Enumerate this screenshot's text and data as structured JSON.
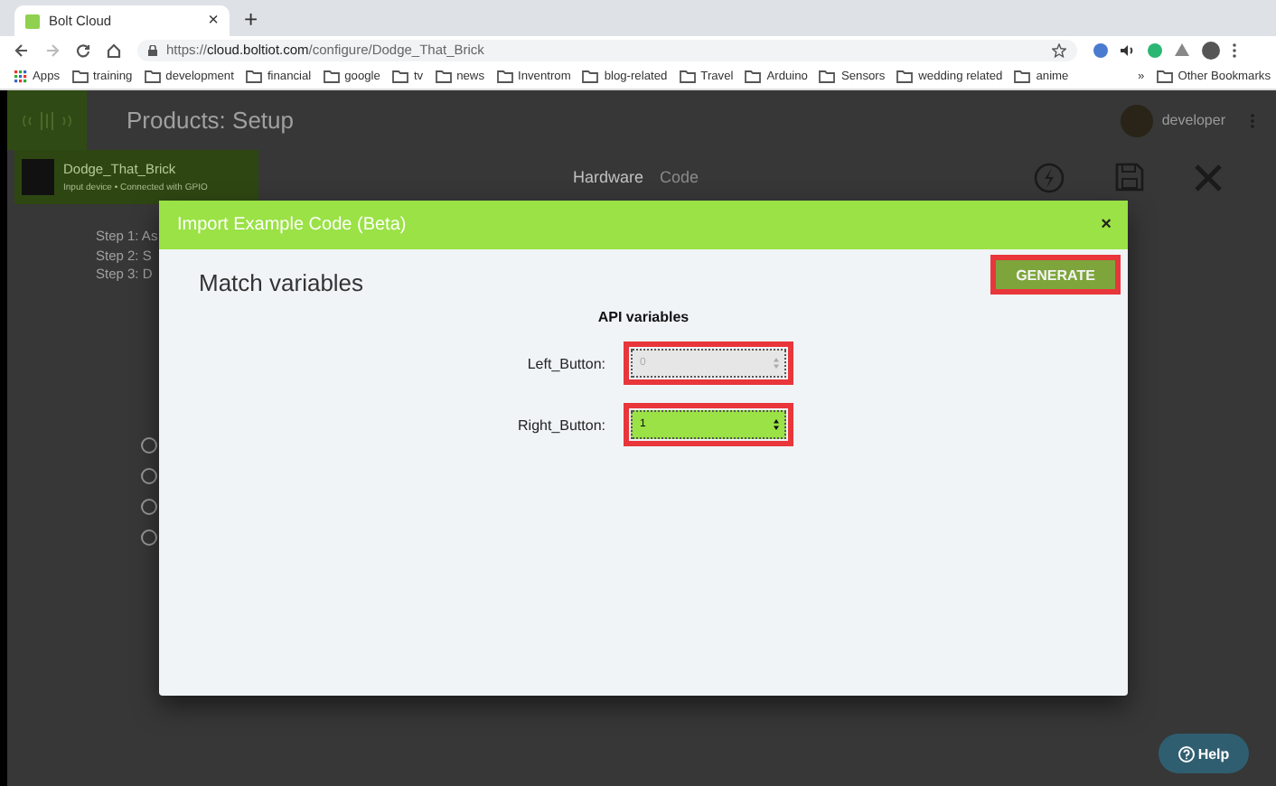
{
  "browser": {
    "tab": {
      "title": "Bolt Cloud",
      "close": "×"
    },
    "new_tab": "+",
    "url": "https://**cloud.boltiot.com**/configure/Dodge_That_Brick",
    "bookmarks": [
      {
        "label": "Apps",
        "kind": "apps"
      },
      {
        "label": "training",
        "kind": "folder"
      },
      {
        "label": "development",
        "kind": "folder"
      },
      {
        "label": "financial",
        "kind": "folder"
      },
      {
        "label": "google",
        "kind": "folder"
      },
      {
        "label": "tv",
        "kind": "folder"
      },
      {
        "label": "news",
        "kind": "folder"
      },
      {
        "label": "Inventrom",
        "kind": "folder"
      },
      {
        "label": "blog-related",
        "kind": "folder"
      },
      {
        "label": "Travel",
        "kind": "folder"
      },
      {
        "label": "Arduino",
        "kind": "folder"
      },
      {
        "label": "Sensors",
        "kind": "folder"
      },
      {
        "label": "wedding related",
        "kind": "folder"
      },
      {
        "label": "anime",
        "kind": "folder"
      }
    ],
    "overflow": "»",
    "other_bookmarks": "Other Bookmarks"
  },
  "app": {
    "title": "Products: Setup",
    "user": "developer",
    "product": {
      "name": "Dodge_That_Brick",
      "subtitle": "Input device • Connected with GPIO"
    },
    "tabs": [
      {
        "label": "Hardware",
        "selected": true
      },
      {
        "label": "Code",
        "selected": false
      }
    ],
    "steps": [
      "Step 1: As",
      "Step 2: S",
      "Step 3: D"
    ],
    "radios": [
      {
        "checked": false
      },
      {
        "checked": false
      },
      {
        "checked": false
      },
      {
        "checked": false
      }
    ]
  },
  "modal": {
    "title": "Import Example Code (Beta)",
    "close": "×",
    "heading": "Match variables",
    "generate": {
      "label": "GENERATE",
      "highlighted": true
    },
    "section": "API variables",
    "fields": [
      {
        "label": "Left_Button:",
        "value": "0",
        "disabled": true,
        "highlighted": true
      },
      {
        "label": "Right_Button:",
        "value": "1",
        "disabled": false,
        "highlighted": true
      }
    ]
  },
  "help": "Help"
}
